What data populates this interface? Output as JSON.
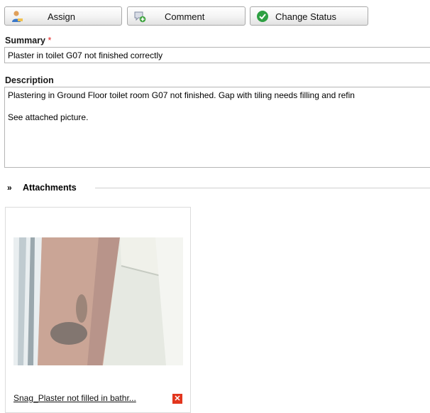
{
  "toolbar": {
    "assign_label": "Assign",
    "comment_label": "Comment",
    "change_status_label": "Change Status"
  },
  "summary": {
    "label": "Summary",
    "required_mark": "*",
    "value": "Plaster in toilet G07 not finished correctly"
  },
  "description": {
    "label": "Description",
    "line1": "Plastering in Ground Floor toilet room G07 not finished. Gap with tiling needs filling and refin",
    "line2": "See attached picture."
  },
  "attachments": {
    "title": "Attachments",
    "items": [
      {
        "filename": "Snag_Plaster not filled in bathr..."
      }
    ]
  },
  "icons": {
    "assign": "assign-user-icon",
    "comment": "add-comment-icon",
    "status": "checkmark-status-icon",
    "collapse": "double-chevron-down-icon",
    "delete": "delete-x-icon"
  },
  "colors": {
    "required": "#e02020",
    "status_green": "#2ea043",
    "delete_red": "#e2361e"
  }
}
